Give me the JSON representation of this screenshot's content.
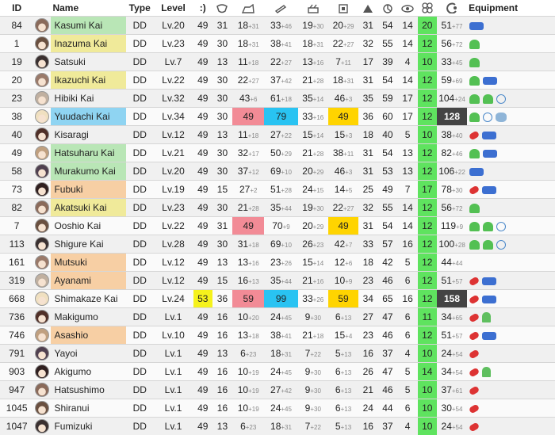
{
  "headers": {
    "id": "ID",
    "name": "Name",
    "type": "Type",
    "level": "Level",
    "morale": ":)",
    "equipment": "Equipment"
  },
  "header_icons": [
    "hp-icon",
    "firepower-icon",
    "torpedo-icon",
    "aa-icon",
    "armor-icon",
    "evasion-icon",
    "asw-icon",
    "los-icon",
    "luck-icon",
    "range-icon"
  ],
  "rows": [
    {
      "id": "84",
      "name": "Kasumi Kai",
      "name_color": "green",
      "type": "DD",
      "level": "Lv.20",
      "morale": "49",
      "hp": "31",
      "fp": "18",
      "fpb": "+31",
      "tp": "33",
      "tpb": "+46",
      "aa": "19",
      "aab": "+30",
      "ar": "20",
      "arb": "+29",
      "ev": "31",
      "asw": "54",
      "los": "14",
      "luck": "20",
      "rng": "51",
      "rngb": "+77",
      "eq": [
        "eq-gun-blue"
      ]
    },
    {
      "id": "1",
      "name": "Inazuma Kai",
      "name_color": "yellow",
      "type": "DD",
      "level": "Lv.23",
      "morale": "49",
      "hp": "30",
      "fp": "18",
      "fpb": "+31",
      "tp": "38",
      "tpb": "+41",
      "aa": "18",
      "aab": "+31",
      "ar": "22",
      "arb": "+27",
      "ev": "32",
      "asw": "55",
      "los": "14",
      "luck": "12",
      "rng": "56",
      "rngb": "+72",
      "eq": [
        "eq-plane-green"
      ]
    },
    {
      "id": "19",
      "name": "Satsuki",
      "name_color": "",
      "type": "DD",
      "level": "Lv.7",
      "morale": "49",
      "hp": "13",
      "fp": "11",
      "fpb": "+18",
      "tp": "22",
      "tpb": "+27",
      "aa": "13",
      "aab": "+16",
      "ar": "7",
      "arb": "+11",
      "ev": "17",
      "asw": "39",
      "los": "4",
      "luck": "10",
      "rng": "33",
      "rngb": "+45",
      "eq": [
        "eq-plane-green"
      ]
    },
    {
      "id": "20",
      "name": "Ikazuchi Kai",
      "name_color": "yellow",
      "type": "DD",
      "level": "Lv.22",
      "morale": "49",
      "hp": "30",
      "fp": "22",
      "fpb": "+27",
      "tp": "37",
      "tpb": "+42",
      "aa": "21",
      "aab": "+28",
      "ar": "18",
      "arb": "+31",
      "ev": "31",
      "asw": "54",
      "los": "14",
      "luck": "12",
      "rng": "59",
      "rngb": "+69",
      "eq": [
        "eq-plane-green",
        "eq-gun-blue"
      ]
    },
    {
      "id": "23",
      "name": "Hibiki Kai",
      "name_color": "",
      "type": "DD",
      "level": "Lv.32",
      "morale": "49",
      "hp": "30",
      "fp": "43",
      "fpb": "+6",
      "tp": "61",
      "tpb": "+18",
      "aa": "35",
      "aab": "+14",
      "ar": "46",
      "arb": "+3",
      "ev": "35",
      "asw": "59",
      "los": "17",
      "luck": "12",
      "rng": "104",
      "rngb": "+24",
      "eq": [
        "eq-plane-green",
        "eq-plane-green",
        "eq-gauge"
      ]
    },
    {
      "id": "38",
      "name": "Yuudachi Kai",
      "name_color": "blue",
      "type": "DD",
      "level": "Lv.34",
      "morale": "49",
      "hp": "30",
      "fp": "49",
      "fpb": "",
      "tp": "79",
      "tpb": "",
      "aa": "33",
      "aab": "+16",
      "ar": "49",
      "arb": "",
      "ev": "36",
      "asw": "60",
      "los": "17",
      "luck": "12",
      "rng": "128",
      "rngb": "",
      "hl": {
        "fp": "hi-red",
        "tp": "hi-blue",
        "ar": "hi-yellow",
        "rng": "dark"
      },
      "eq": [
        "eq-plane-green",
        "eq-gauge",
        "eq-depth"
      ]
    },
    {
      "id": "40",
      "name": "Kisaragi",
      "name_color": "",
      "type": "DD",
      "level": "Lv.12",
      "morale": "49",
      "hp": "13",
      "fp": "11",
      "fpb": "+18",
      "tp": "27",
      "tpb": "+22",
      "aa": "15",
      "aab": "+14",
      "ar": "15",
      "arb": "+3",
      "ev": "18",
      "asw": "40",
      "los": "5",
      "luck": "10",
      "rng": "38",
      "rngb": "+40",
      "eq": [
        "eq-torp-red",
        "eq-gun-blue"
      ]
    },
    {
      "id": "49",
      "name": "Hatsuharu Kai",
      "name_color": "green",
      "type": "DD",
      "level": "Lv.21",
      "morale": "49",
      "hp": "30",
      "fp": "32",
      "fpb": "+17",
      "tp": "50",
      "tpb": "+29",
      "aa": "21",
      "aab": "+28",
      "ar": "38",
      "arb": "+11",
      "ev": "31",
      "asw": "54",
      "los": "13",
      "luck": "12",
      "rng": "82",
      "rngb": "+46",
      "eq": [
        "eq-plane-green",
        "eq-gun-blue"
      ]
    },
    {
      "id": "58",
      "name": "Murakumo Kai",
      "name_color": "green",
      "type": "DD",
      "level": "Lv.20",
      "morale": "49",
      "hp": "30",
      "fp": "37",
      "fpb": "+12",
      "tp": "69",
      "tpb": "+10",
      "aa": "20",
      "aab": "+29",
      "ar": "46",
      "arb": "+3",
      "ev": "31",
      "asw": "53",
      "los": "13",
      "luck": "12",
      "rng": "106",
      "rngb": "+22",
      "eq": [
        "eq-gun-blue"
      ]
    },
    {
      "id": "73",
      "name": "Fubuki",
      "name_color": "orange",
      "type": "DD",
      "level": "Lv.19",
      "morale": "49",
      "hp": "15",
      "fp": "27",
      "fpb": "+2",
      "tp": "51",
      "tpb": "+28",
      "aa": "24",
      "aab": "+15",
      "ar": "14",
      "arb": "+5",
      "ev": "25",
      "asw": "49",
      "los": "7",
      "luck": "17",
      "rng": "78",
      "rngb": "+30",
      "eq": [
        "eq-torp-red",
        "eq-gun-blue"
      ]
    },
    {
      "id": "82",
      "name": "Akatsuki Kai",
      "name_color": "yellow",
      "type": "DD",
      "level": "Lv.23",
      "morale": "49",
      "hp": "30",
      "fp": "21",
      "fpb": "+28",
      "tp": "35",
      "tpb": "+44",
      "aa": "19",
      "aab": "+30",
      "ar": "22",
      "arb": "+27",
      "ev": "32",
      "asw": "55",
      "los": "14",
      "luck": "12",
      "rng": "56",
      "rngb": "+72",
      "eq": [
        "eq-plane-green"
      ]
    },
    {
      "id": "7",
      "name": "Ooshio Kai",
      "name_color": "",
      "type": "DD",
      "level": "Lv.22",
      "morale": "49",
      "hp": "31",
      "fp": "49",
      "fpb": "",
      "tp": "70",
      "tpb": "+9",
      "aa": "20",
      "aab": "+29",
      "ar": "49",
      "arb": "",
      "ev": "31",
      "asw": "54",
      "los": "14",
      "luck": "12",
      "rng": "119",
      "rngb": "+9",
      "hl": {
        "fp": "hi-red",
        "ar": "hi-yellow"
      },
      "eq": [
        "eq-plane-green",
        "eq-plane-green",
        "eq-gauge"
      ]
    },
    {
      "id": "113",
      "name": "Shigure Kai",
      "name_color": "",
      "type": "DD",
      "level": "Lv.28",
      "morale": "49",
      "hp": "30",
      "fp": "31",
      "fpb": "+18",
      "tp": "69",
      "tpb": "+10",
      "aa": "26",
      "aab": "+23",
      "ar": "42",
      "arb": "+7",
      "ev": "33",
      "asw": "57",
      "los": "16",
      "luck": "12",
      "rng": "100",
      "rngb": "+28",
      "eq": [
        "eq-plane-green",
        "eq-plane-green",
        "eq-gauge"
      ]
    },
    {
      "id": "161",
      "name": "Mutsuki",
      "name_color": "orange",
      "type": "DD",
      "level": "Lv.12",
      "morale": "49",
      "hp": "13",
      "fp": "13",
      "fpb": "+16",
      "tp": "23",
      "tpb": "+26",
      "aa": "15",
      "aab": "+14",
      "ar": "12",
      "arb": "+6",
      "ev": "18",
      "asw": "42",
      "los": "5",
      "luck": "12",
      "rng": "44",
      "rngb": "+44",
      "eq": []
    },
    {
      "id": "319",
      "name": "Ayanami",
      "name_color": "orange",
      "type": "DD",
      "level": "Lv.12",
      "morale": "49",
      "hp": "15",
      "fp": "16",
      "fpb": "+13",
      "tp": "35",
      "tpb": "+44",
      "aa": "21",
      "aab": "+16",
      "ar": "10",
      "arb": "+9",
      "ev": "23",
      "asw": "46",
      "los": "6",
      "luck": "12",
      "rng": "51",
      "rngb": "+57",
      "eq": [
        "eq-torp-red",
        "eq-gun-blue"
      ]
    },
    {
      "id": "668",
      "name": "Shimakaze Kai",
      "name_color": "",
      "type": "DD",
      "level": "Lv.24",
      "morale": "53",
      "hp": "36",
      "fp": "59",
      "fpb": "",
      "tp": "99",
      "tpb": "",
      "aa": "33",
      "aab": "+26",
      "ar": "59",
      "arb": "",
      "ev": "34",
      "asw": "65",
      "los": "16",
      "luck": "12",
      "rng": "158",
      "rngb": "",
      "hl": {
        "morale": "hi-lemon",
        "fp": "hi-red",
        "tp": "hi-blue",
        "ar": "hi-yellow",
        "rng": "dark"
      },
      "eq": [
        "eq-torp-red",
        "eq-gun-blue"
      ]
    },
    {
      "id": "736",
      "name": "Makigumo",
      "name_color": "",
      "type": "DD",
      "level": "Lv.1",
      "morale": "49",
      "hp": "16",
      "fp": "10",
      "fpb": "+20",
      "tp": "24",
      "tpb": "+45",
      "aa": "9",
      "aab": "+30",
      "ar": "6",
      "arb": "+13",
      "ev": "27",
      "asw": "47",
      "los": "6",
      "luck": "11",
      "rng": "34",
      "rngb": "+65",
      "eq": [
        "eq-torp-red",
        "eq-radar-green"
      ]
    },
    {
      "id": "746",
      "name": "Asashio",
      "name_color": "orange",
      "type": "DD",
      "level": "Lv.10",
      "morale": "49",
      "hp": "16",
      "fp": "13",
      "fpb": "+18",
      "tp": "38",
      "tpb": "+41",
      "aa": "21",
      "aab": "+18",
      "ar": "15",
      "arb": "+4",
      "ev": "23",
      "asw": "46",
      "los": "6",
      "luck": "12",
      "rng": "51",
      "rngb": "+57",
      "eq": [
        "eq-torp-red",
        "eq-gun-blue"
      ]
    },
    {
      "id": "791",
      "name": "Yayoi",
      "name_color": "",
      "type": "DD",
      "level": "Lv.1",
      "morale": "49",
      "hp": "13",
      "fp": "6",
      "fpb": "+23",
      "tp": "18",
      "tpb": "+31",
      "aa": "7",
      "aab": "+22",
      "ar": "5",
      "arb": "+13",
      "ev": "16",
      "asw": "37",
      "los": "4",
      "luck": "10",
      "rng": "24",
      "rngb": "+54",
      "eq": [
        "eq-torp-red"
      ]
    },
    {
      "id": "903",
      "name": "Akigumo",
      "name_color": "",
      "type": "DD",
      "level": "Lv.1",
      "morale": "49",
      "hp": "16",
      "fp": "10",
      "fpb": "+19",
      "tp": "24",
      "tpb": "+45",
      "aa": "9",
      "aab": "+30",
      "ar": "6",
      "arb": "+13",
      "ev": "26",
      "asw": "47",
      "los": "5",
      "luck": "14",
      "rng": "34",
      "rngb": "+54",
      "eq": [
        "eq-torp-red",
        "eq-radar-green"
      ]
    },
    {
      "id": "947",
      "name": "Hatsushimo",
      "name_color": "",
      "type": "DD",
      "level": "Lv.1",
      "morale": "49",
      "hp": "16",
      "fp": "10",
      "fpb": "+19",
      "tp": "27",
      "tpb": "+42",
      "aa": "9",
      "aab": "+30",
      "ar": "6",
      "arb": "+13",
      "ev": "21",
      "asw": "46",
      "los": "5",
      "luck": "10",
      "rng": "37",
      "rngb": "+61",
      "eq": [
        "eq-torp-red"
      ]
    },
    {
      "id": "1045",
      "name": "Shiranui",
      "name_color": "",
      "type": "DD",
      "level": "Lv.1",
      "morale": "49",
      "hp": "16",
      "fp": "10",
      "fpb": "+19",
      "tp": "24",
      "tpb": "+45",
      "aa": "9",
      "aab": "+30",
      "ar": "6",
      "arb": "+13",
      "ev": "24",
      "asw": "44",
      "los": "6",
      "luck": "10",
      "rng": "30",
      "rngb": "+54",
      "eq": [
        "eq-torp-red"
      ]
    },
    {
      "id": "1047",
      "name": "Fumizuki",
      "name_color": "",
      "type": "DD",
      "level": "Lv.1",
      "morale": "49",
      "hp": "13",
      "fp": "6",
      "fpb": "+23",
      "tp": "18",
      "tpb": "+31",
      "aa": "7",
      "aab": "+22",
      "ar": "5",
      "arb": "+13",
      "ev": "16",
      "asw": "37",
      "los": "4",
      "luck": "10",
      "rng": "24",
      "rngb": "+54",
      "eq": [
        "eq-torp-red"
      ]
    }
  ],
  "colors": {
    "green": "#b9e6b6",
    "yellow": "#f0ea9a",
    "blue": "#8fd4f2",
    "orange": "#f7cfa4",
    "luck": "#5fe35f"
  }
}
